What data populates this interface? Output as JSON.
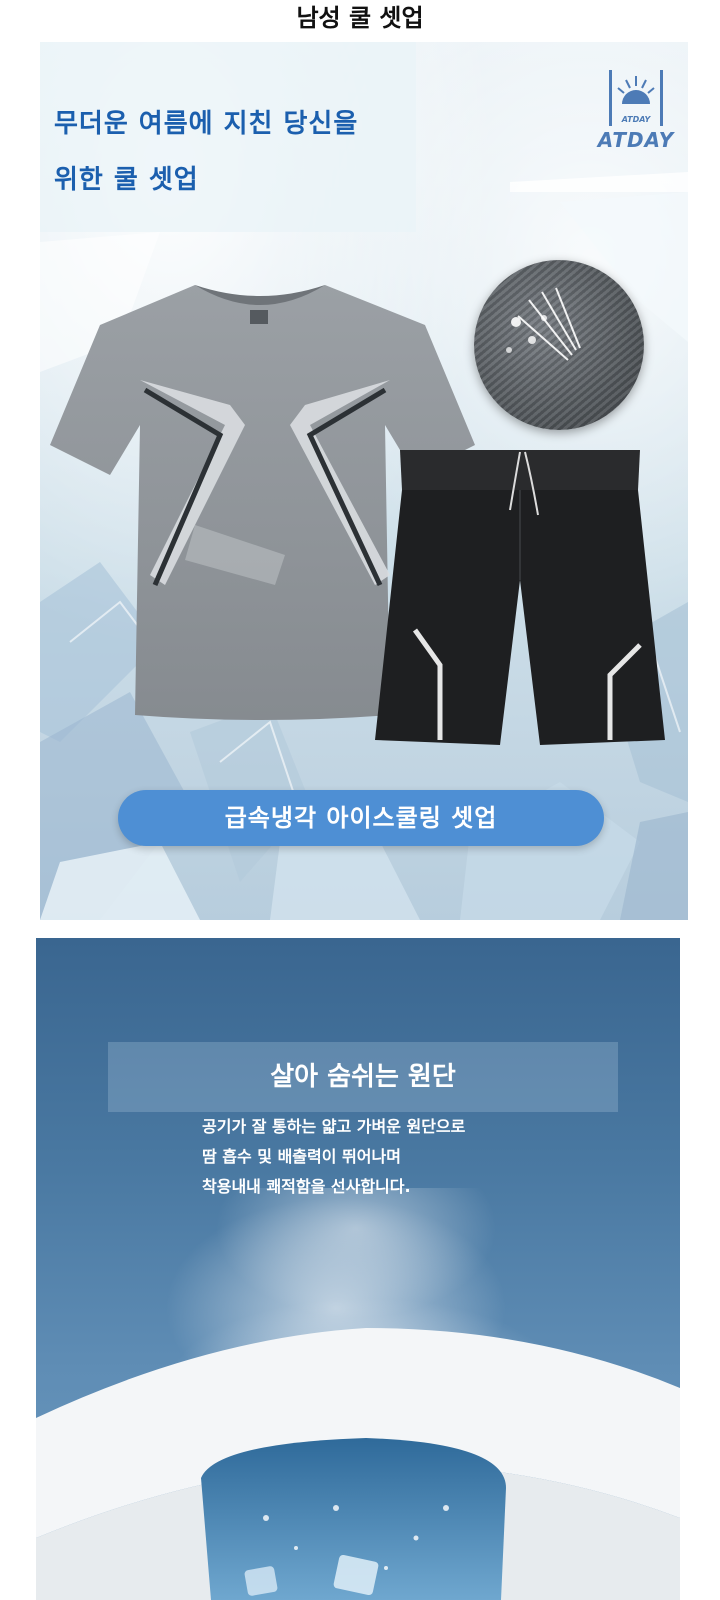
{
  "page": {
    "title": "남성 쿨 셋업"
  },
  "hero": {
    "headline_line1": "무더운 여름에 지친 당신을",
    "headline_line2": "위한 쿨 셋업",
    "logo_small": "ATDAY",
    "logo_text": "ATDAY",
    "cta_label": "급속냉각  아이스쿨링 셋업"
  },
  "feature": {
    "title": "살아 숨쉬는 원단",
    "description": [
      "공기가 잘 통하는 얇고 가벼운 원단으로",
      "땀 흡수 및 배출력이 뛰어나며",
      "착용내내 쾌적함을 선사합니다."
    ]
  },
  "colors": {
    "headline_blue": "#1b5fae",
    "logo_blue": "#4d7bb6",
    "pill_blue": "#4e8fd4",
    "tshirt_gray": "#8f9499",
    "shorts_black": "#1e1f21",
    "feature_bg": "#4a79a2"
  },
  "icons": {
    "logo": "sunrise-frame-icon",
    "fabric": "fabric-closeup-icon"
  }
}
